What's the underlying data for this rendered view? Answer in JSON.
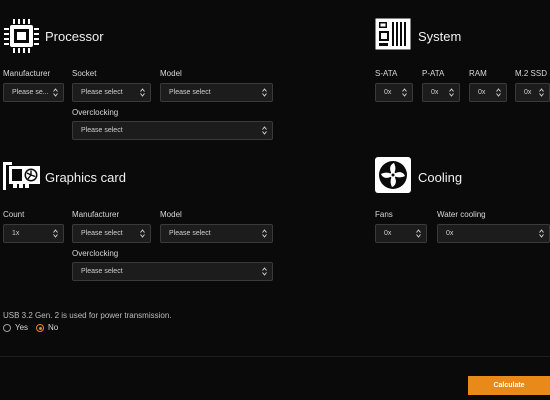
{
  "processor": {
    "title": "Processor",
    "labels": {
      "manufacturer": "Manufacturer",
      "socket": "Socket",
      "model": "Model",
      "overclocking": "Overclocking"
    },
    "values": {
      "manufacturer": "Please se...",
      "socket": "Please select",
      "model": "Please select",
      "overclocking": "Please select"
    }
  },
  "system": {
    "title": "System",
    "labels": {
      "sata": "S-ATA",
      "pata": "P-ATA",
      "ram": "RAM",
      "m2": "M.2 SSD"
    },
    "values": {
      "sata": "0x",
      "pata": "0x",
      "ram": "0x",
      "m2": "0x"
    }
  },
  "graphics": {
    "title": "Graphics card",
    "labels": {
      "count": "Count",
      "manufacturer": "Manufacturer",
      "model": "Model",
      "overclocking": "Overclocking"
    },
    "values": {
      "count": "1x",
      "manufacturer": "Please select",
      "model": "Please select",
      "overclocking": "Please select"
    }
  },
  "cooling": {
    "title": "Cooling",
    "labels": {
      "fans": "Fans",
      "water": "Water cooling"
    },
    "values": {
      "fans": "0x",
      "water": "0x"
    }
  },
  "usb": {
    "question": "USB 3.2 Gen. 2 is used for power transmission.",
    "options": [
      {
        "label": "Yes",
        "selected": false
      },
      {
        "label": "No",
        "selected": true
      }
    ]
  },
  "actions": {
    "calculate": "Calculate"
  },
  "colors": {
    "accent": "#e8891a",
    "background": "#0a0a0a",
    "field": "#1c1c1c"
  }
}
